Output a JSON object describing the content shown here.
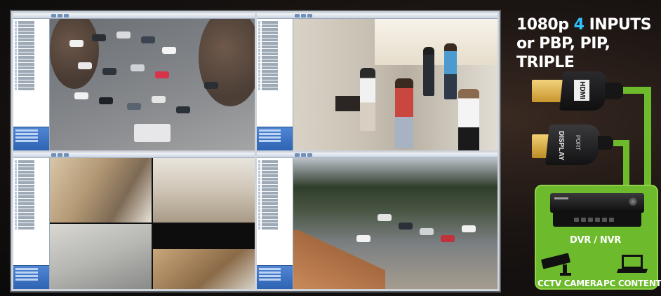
{
  "promo": {
    "headline_part1": "1080p ",
    "headline_accent": "4",
    "headline_part2": " INPUTS",
    "headline_line2": "or PBP, PIP, TRIPLE",
    "hdmi_label": "HDMI",
    "dp_label": "DISPLAY",
    "dp_sublabel": "PORT",
    "device_label": "DVR / NVR",
    "camera_label": "CCTV CAMERA",
    "pc_label": "PC CONTENTS"
  },
  "colors": {
    "accent_blue": "#2fc3ff",
    "brand_green": "#6dbb2d",
    "app_blue": "#2f63b3"
  },
  "panes": [
    {
      "view": "parking-lot"
    },
    {
      "view": "walkway"
    },
    {
      "view": "office-quad"
    },
    {
      "view": "campus"
    }
  ]
}
